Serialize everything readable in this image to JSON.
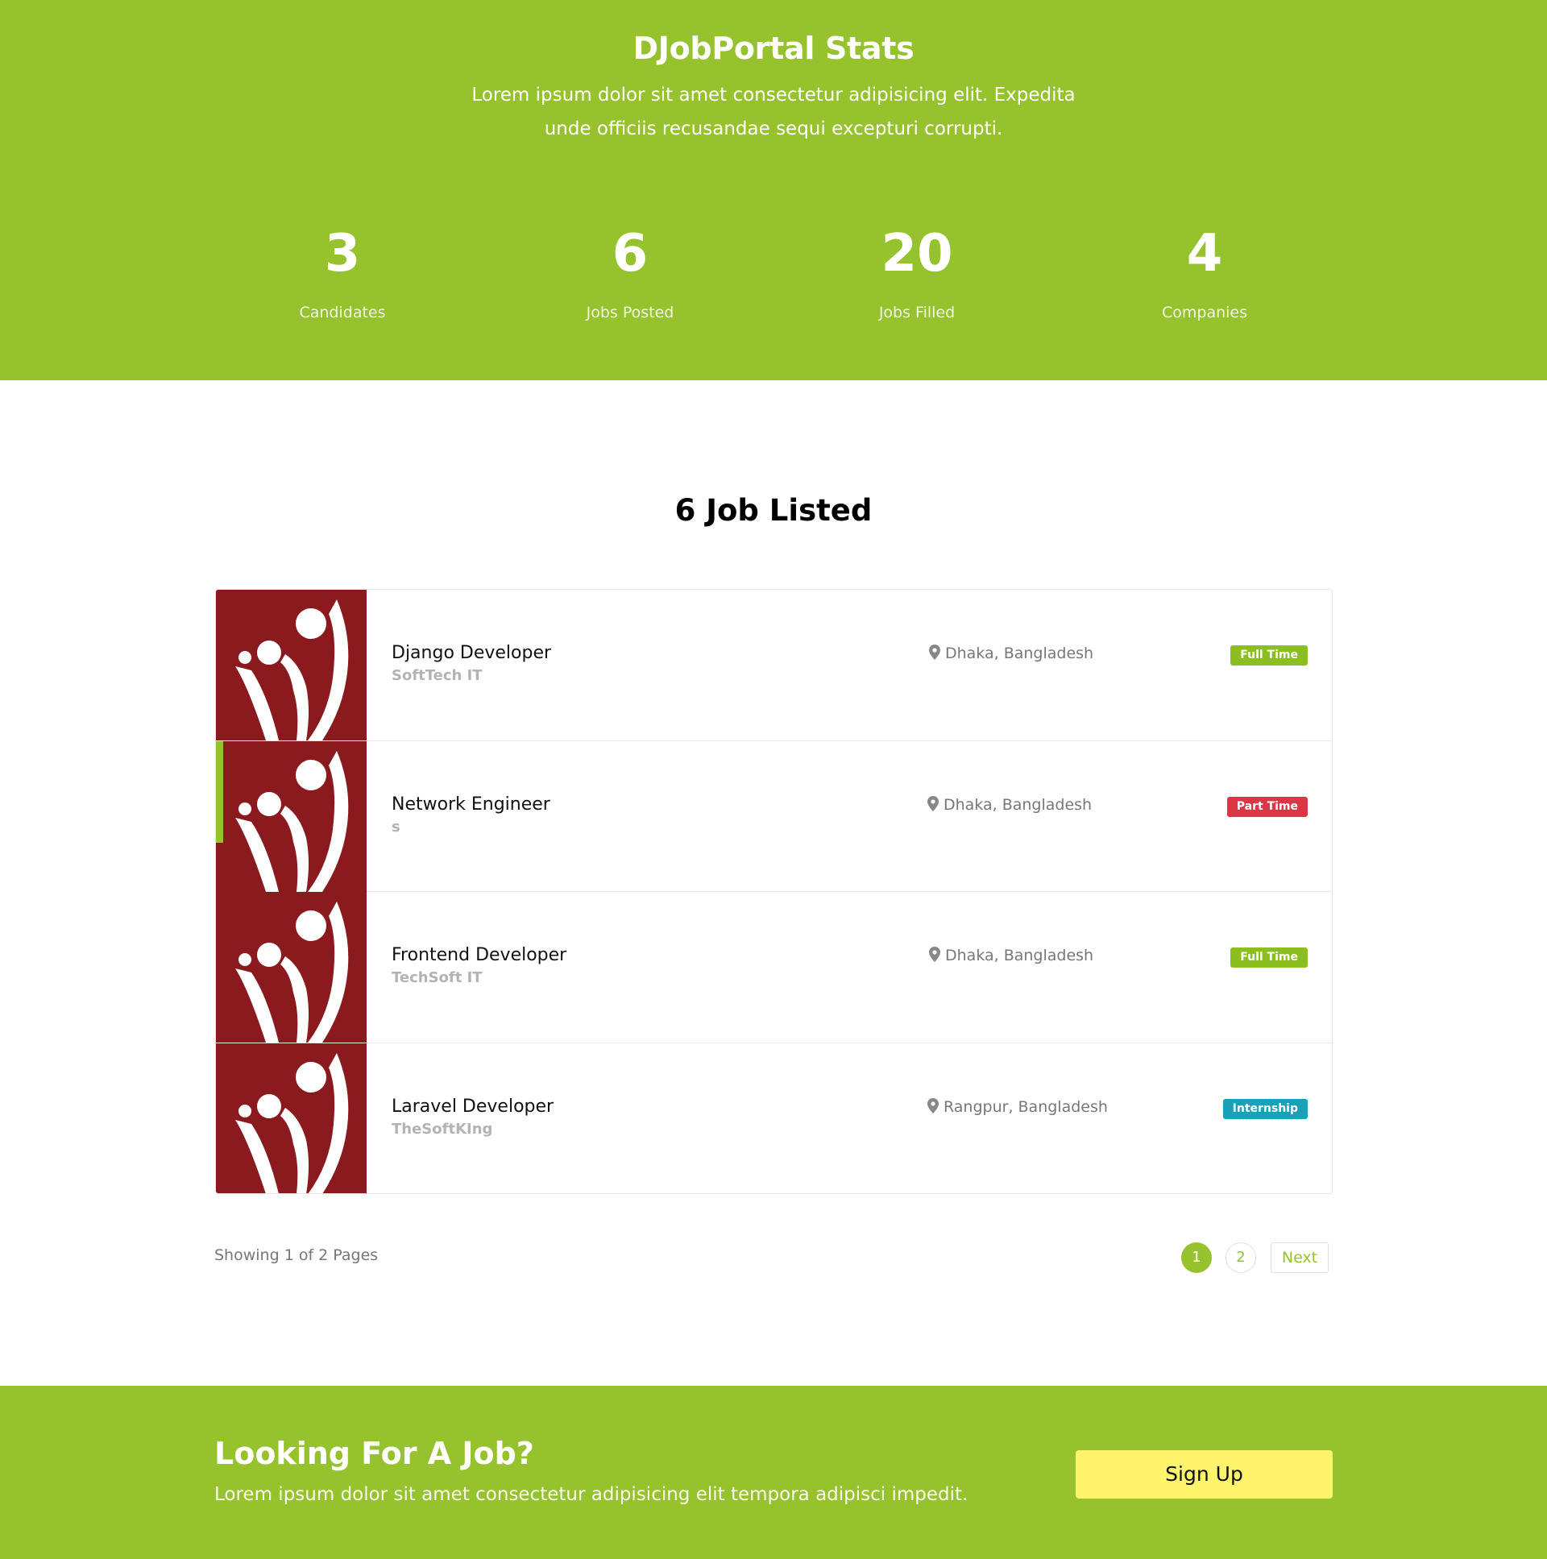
{
  "stats": {
    "title": "DJobPortal Stats",
    "description": "Lorem ipsum dolor sit amet consectetur adipisicing elit. Expedita unde officiis recusandae sequi excepturi corrupti.",
    "items": [
      {
        "value": "3",
        "label": "Candidates"
      },
      {
        "value": "6",
        "label": "Jobs Posted"
      },
      {
        "value": "20",
        "label": "Jobs Filled"
      },
      {
        "value": "4",
        "label": "Companies"
      }
    ]
  },
  "jobs": {
    "heading": "6 Job Listed",
    "items": [
      {
        "title": "Django Developer",
        "company": "SoftTech IT",
        "location": "Dhaka, Bangladesh",
        "type": "Full Time",
        "type_color": "#8bbf1f"
      },
      {
        "title": "Network Engineer",
        "company": "s",
        "location": "Dhaka, Bangladesh",
        "type": "Part Time",
        "type_color": "#dc3545"
      },
      {
        "title": "Frontend Developer",
        "company": "TechSoft IT",
        "location": "Dhaka, Bangladesh",
        "type": "Full Time",
        "type_color": "#8bbf1f"
      },
      {
        "title": "Laravel Developer",
        "company": "TheSoftKIng",
        "location": "Rangpur, Bangladesh",
        "type": "Internship",
        "type_color": "#17a2b8"
      }
    ]
  },
  "pagination": {
    "showing": "Showing 1 of 2 Pages",
    "pages": [
      "1",
      "2"
    ],
    "next": "Next"
  },
  "cta": {
    "title": "Looking For A Job?",
    "description": "Lorem ipsum dolor sit amet consectetur adipisicing elit tempora adipisci impedit.",
    "button": "Sign Up"
  },
  "colors": {
    "brand_green": "#96c22d",
    "logo_red": "#8b1a1f",
    "signup_yellow": "#fff46b"
  },
  "icons": {
    "location": "map-pin-icon",
    "logo": "company-logo-icon"
  }
}
